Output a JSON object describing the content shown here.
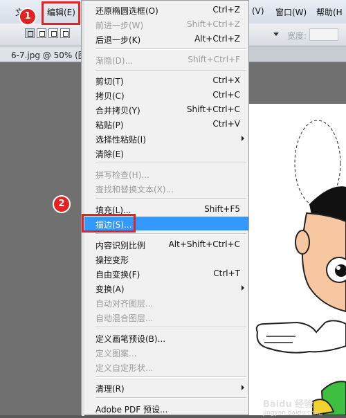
{
  "menubar": {
    "file_label": "文",
    "edit_label": "编辑(E)",
    "view_label": "(V)",
    "window_label": "窗口(W)",
    "help_label": "帮助(H"
  },
  "options_bar": {
    "width_label": "宽度:",
    "width_value": ""
  },
  "document_tab": {
    "title": "6-7.jpg @ 50% (图"
  },
  "steps": {
    "step1": "1",
    "step2": "2"
  },
  "edit_menu": {
    "items": [
      {
        "label": "还原椭圆选框(O)",
        "shortcut": "Ctrl+Z",
        "enabled": true
      },
      {
        "label": "前进一步(W)",
        "shortcut": "Shift+Ctrl+Z",
        "enabled": false
      },
      {
        "label": "后退一步(K)",
        "shortcut": "Alt+Ctrl+Z",
        "enabled": true
      },
      {
        "label": "渐隐(D)...",
        "shortcut": "Shift+Ctrl+F",
        "enabled": false
      },
      {
        "label": "剪切(T)",
        "shortcut": "Ctrl+X",
        "enabled": true
      },
      {
        "label": "拷贝(C)",
        "shortcut": "Ctrl+C",
        "enabled": true
      },
      {
        "label": "合并拷贝(Y)",
        "shortcut": "Shift+Ctrl+C",
        "enabled": true
      },
      {
        "label": "粘贴(P)",
        "shortcut": "Ctrl+V",
        "enabled": true
      },
      {
        "label": "选择性粘贴(I)",
        "shortcut": "",
        "enabled": true,
        "submenu": true
      },
      {
        "label": "清除(E)",
        "shortcut": "",
        "enabled": true
      },
      {
        "label": "拼写检查(H)...",
        "shortcut": "",
        "enabled": false
      },
      {
        "label": "查找和替换文本(X)...",
        "shortcut": "",
        "enabled": false
      },
      {
        "label": "填充(L)...",
        "shortcut": "Shift+F5",
        "enabled": true
      },
      {
        "label": "描边(S)...",
        "shortcut": "",
        "enabled": true,
        "highlighted": true
      },
      {
        "label": "内容识别比例",
        "shortcut": "Alt+Shift+Ctrl+C",
        "enabled": true
      },
      {
        "label": "操控变形",
        "shortcut": "",
        "enabled": true
      },
      {
        "label": "自由变换(F)",
        "shortcut": "Ctrl+T",
        "enabled": true
      },
      {
        "label": "变换(A)",
        "shortcut": "",
        "enabled": true,
        "submenu": true
      },
      {
        "label": "自动对齐图层...",
        "shortcut": "",
        "enabled": false
      },
      {
        "label": "自动混合图层...",
        "shortcut": "",
        "enabled": false
      },
      {
        "label": "定义画笔预设(B)...",
        "shortcut": "",
        "enabled": true
      },
      {
        "label": "定义图案...",
        "shortcut": "",
        "enabled": false
      },
      {
        "label": "定义自定形状...",
        "shortcut": "",
        "enabled": false
      },
      {
        "label": "清理(R)",
        "shortcut": "",
        "enabled": true,
        "submenu": true
      },
      {
        "label": "Adobe PDF 预设...",
        "shortcut": "",
        "enabled": true
      }
    ]
  },
  "watermark": {
    "text": "Baidu 经验",
    "sub": "jingyan.baidu.com"
  },
  "colors": {
    "highlight": "#3399ff",
    "annotation_red": "#e32222"
  }
}
